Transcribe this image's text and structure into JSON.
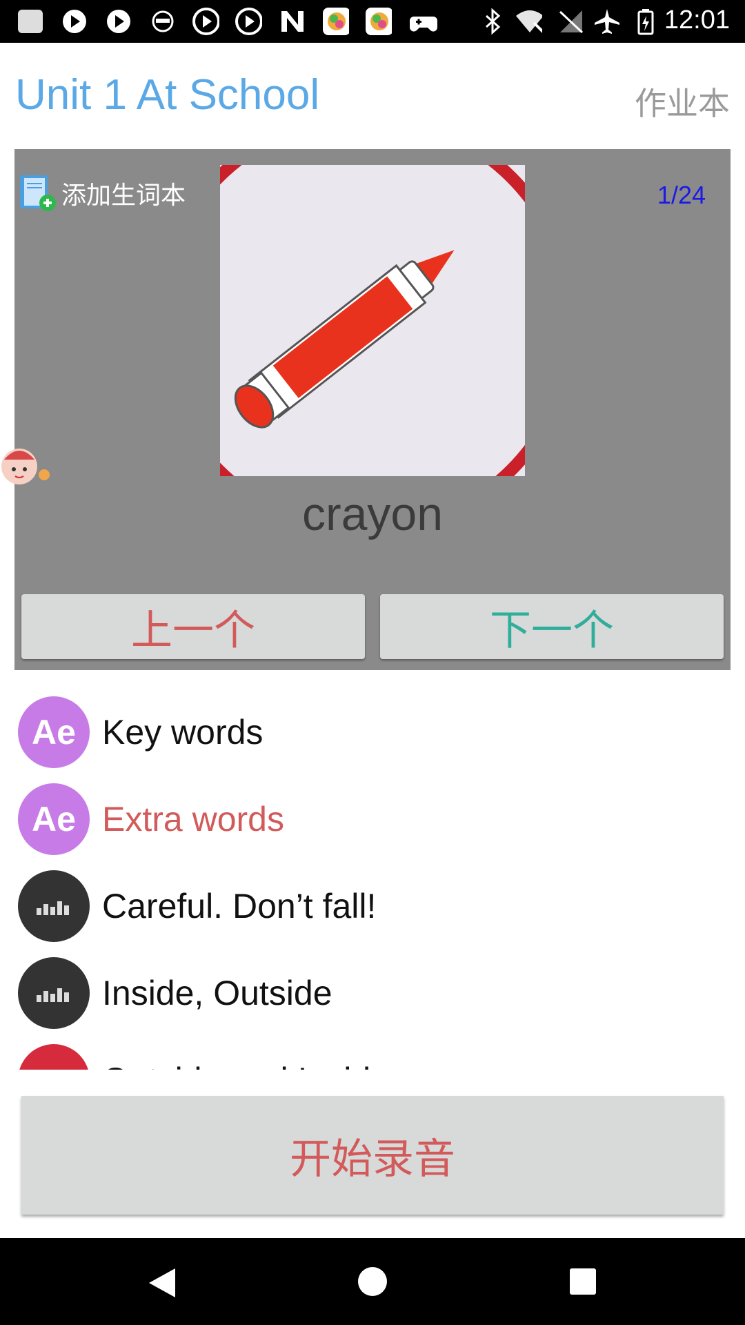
{
  "status_bar": {
    "time": "12:01",
    "icons": [
      "app-icon",
      "play-icon",
      "play-icon",
      "glasses-icon",
      "play-circle-icon",
      "play-circle-icon",
      "n-icon",
      "game-icon",
      "game-icon",
      "gamepad-icon",
      "bluetooth-icon",
      "wifi-off-icon",
      "signal-off-icon",
      "airplane-icon",
      "battery-icon"
    ]
  },
  "header": {
    "title": "Unit 1 At School",
    "link": "作业本"
  },
  "card": {
    "add_vocab_label": "添加生词本",
    "counter": "1/24",
    "word": "crayon",
    "image_name": "crayon-image"
  },
  "nav": {
    "prev": "上一个",
    "next": "下一个"
  },
  "list": [
    {
      "label": "Key words",
      "icon": "ae-icon",
      "active": false
    },
    {
      "label": "Extra words",
      "icon": "ae-icon",
      "active": true
    },
    {
      "label": "Careful. Don’t fall!",
      "icon": "equalizer-icon",
      "active": false
    },
    {
      "label": "Inside, Outside",
      "icon": "equalizer-icon",
      "active": false
    },
    {
      "label": "Outside and Inside",
      "icon": "book-icon",
      "active": false
    }
  ],
  "record_button": "开始录音",
  "colors": {
    "title": "#5aa9e6",
    "prev": "#d25a5a",
    "next": "#2fae9a",
    "counter": "#1a1ae6",
    "card_bg": "#8a8a8a"
  }
}
